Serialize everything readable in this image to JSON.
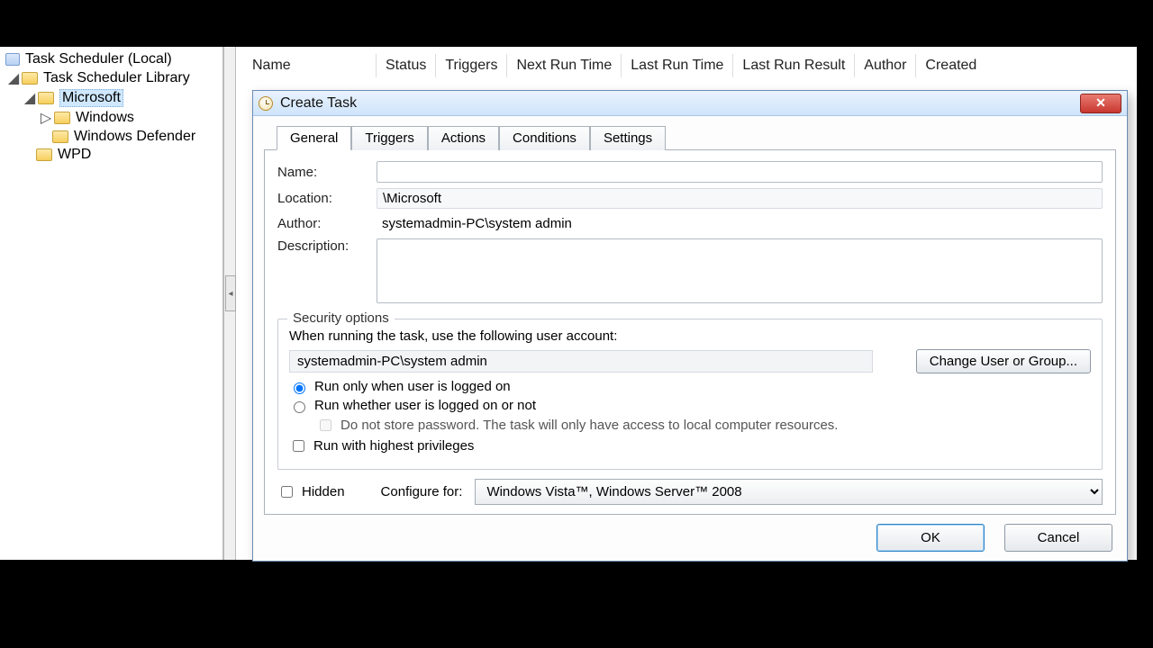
{
  "tree": {
    "root": "Task Scheduler (Local)",
    "library": "Task Scheduler Library",
    "microsoft": "Microsoft",
    "windows": "Windows",
    "defender": "Windows Defender",
    "wpd": "WPD"
  },
  "columns": [
    "Name",
    "Status",
    "Triggers",
    "Next Run Time",
    "Last Run Time",
    "Last Run Result",
    "Author",
    "Created"
  ],
  "dialog": {
    "title": "Create Task",
    "tabs": [
      "General",
      "Triggers",
      "Actions",
      "Conditions",
      "Settings"
    ],
    "active_tab": 0,
    "labels": {
      "name": "Name:",
      "location": "Location:",
      "author": "Author:",
      "description": "Description:"
    },
    "values": {
      "name": "",
      "location": "\\Microsoft",
      "author": "systemadmin-PC\\system admin",
      "description": ""
    },
    "security": {
      "legend": "Security options",
      "prompt": "When running the task, use the following user account:",
      "account": "systemadmin-PC\\system admin",
      "change_btn": "Change User or Group...",
      "radio_logged_on": "Run only when user is logged on",
      "radio_whether": "Run whether user is logged on or not",
      "no_store_pw": "Do not store password.  The task will only have access to local computer resources.",
      "highest_priv": "Run with highest privileges"
    },
    "hidden_label": "Hidden",
    "configure_label": "Configure for:",
    "configure_value": "Windows Vista™, Windows Server™ 2008",
    "ok": "OK",
    "cancel": "Cancel"
  }
}
